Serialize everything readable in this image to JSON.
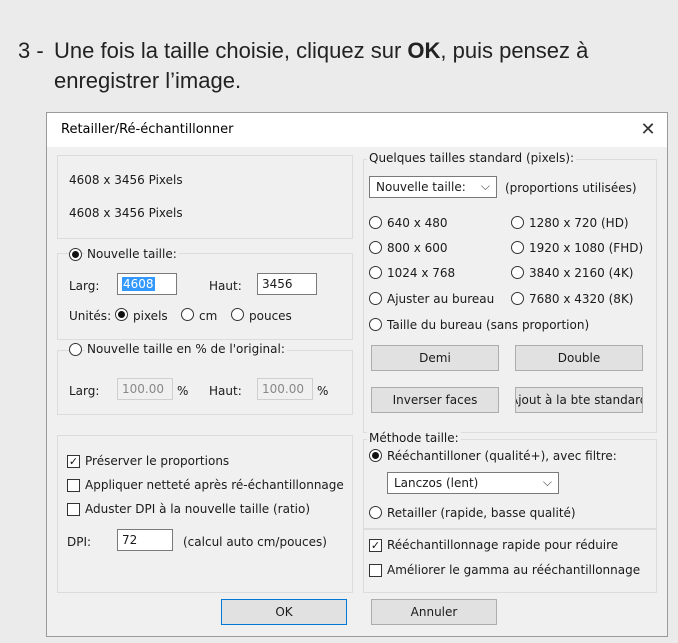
{
  "instruction": {
    "number": "3 -",
    "before": "Une fois la taille choisie, cliquez sur ",
    "bold": "OK",
    "after": ", puis pensez à enregistrer l’image."
  },
  "dialog": {
    "title": "Retailler/Ré-échantillonner",
    "close": "✕",
    "current_size_1": "4608  x  3456  Pixels",
    "current_size_2": "4608  x  3456  Pixels",
    "new_size": {
      "radio_label": "Nouvelle taille:",
      "width_label": "Larg:",
      "width_value": "4608",
      "height_label": "Haut:",
      "height_value": "3456",
      "units_label": "Unités:",
      "unit_pixels": "pixels",
      "unit_cm": "cm",
      "unit_inches": "pouces"
    },
    "percent": {
      "radio_label": "Nouvelle taille en % de l'original:",
      "width_label": "Larg:",
      "width_value": "100.00",
      "height_label": "Haut:",
      "height_value": "100.00",
      "unit": "%"
    },
    "options": {
      "preserve": "Préserver le proportions",
      "sharpen": "Appliquer netteté après ré-échantillonnage",
      "adjust_dpi": "Aduster DPI à la nouvelle taille (ratio)",
      "dpi_label": "DPI:",
      "dpi_value": "72",
      "dpi_note": "(calcul auto cm/pouces)"
    },
    "standard": {
      "group_label": "Quelques tailles standard (pixels):",
      "select_value": "Nouvelle taille:",
      "proportions_note": "(proportions utilisées)",
      "sizes_left": [
        "640 x 480",
        "800 x 600",
        "1024 x 768",
        "Ajuster au bureau"
      ],
      "sizes_right": [
        "1280 x 720  (HD)",
        "1920 x 1080 (FHD)",
        "3840 x 2160 (4K)",
        "7680 x 4320 (8K)"
      ],
      "desktop_size": "Taille du bureau (sans proportion)",
      "half_button": "Demi",
      "double_button": "Double",
      "swap_button": "Inverser faces",
      "add_button": "Ajout à la bte standard"
    },
    "method": {
      "group_label": "Méthode taille:",
      "resample": "Rééchantilloner (qualité+), avec filtre:",
      "filter_value": "Lanczos (lent)",
      "resize": "Retailler (rapide, basse qualité)",
      "fast_resample": "Rééchantillonnage rapide pour réduire",
      "gamma": "Améliorer le gamma au rééchantillonnage"
    },
    "ok_button": "OK",
    "cancel_button": "Annuler"
  }
}
